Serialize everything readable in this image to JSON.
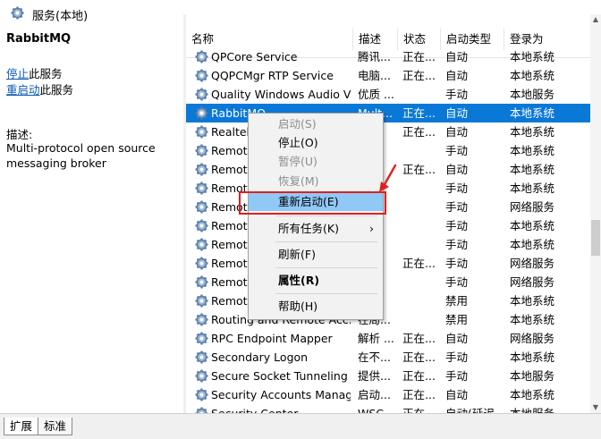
{
  "window": {
    "title": "服务(本地)",
    "icon": "services-gear-icon"
  },
  "left_panel": {
    "service_name": "RabbitMQ",
    "stop_link": "停止",
    "stop_suffix": "此服务",
    "restart_link": "重启动",
    "restart_suffix": "此服务",
    "desc_label": "描述:",
    "description": "Multi-protocol open source messaging broker"
  },
  "columns": [
    "名称",
    "描述",
    "状态",
    "启动类型",
    "登录为"
  ],
  "rows": [
    {
      "name": "QPCore Service",
      "desc": "腾讯...",
      "status": "正在...",
      "startup": "自动",
      "logon": "本地系统"
    },
    {
      "name": "QQPCMgr RTP Service",
      "desc": "电脑...",
      "status": "正在...",
      "startup": "自动",
      "logon": "本地系统"
    },
    {
      "name": "Quality Windows Audio V...",
      "desc": "优质 ...",
      "status": "",
      "startup": "手动",
      "logon": "本地服务"
    },
    {
      "name": "RabbitMQ",
      "desc": "Mult...",
      "status": "正在...",
      "startup": "自动",
      "logon": "本地系统"
    },
    {
      "name": "Realtek...",
      "desc": "",
      "status": "正在...",
      "startup": "自动",
      "logon": "本地系统"
    },
    {
      "name": "Remote...",
      "desc": "",
      "status": "",
      "startup": "手动",
      "logon": "本地系统"
    },
    {
      "name": "Remote...",
      "desc": "",
      "status": "正在...",
      "startup": "自动",
      "logon": "本地系统"
    },
    {
      "name": "Remote...",
      "desc": "",
      "status": "",
      "startup": "手动",
      "logon": "本地系统"
    },
    {
      "name": "Remote...",
      "desc": "",
      "status": "",
      "startup": "手动",
      "logon": "网络服务"
    },
    {
      "name": "Remote...",
      "desc": "",
      "status": "",
      "startup": "手动",
      "logon": "本地系统"
    },
    {
      "name": "Remote...",
      "desc": "",
      "status": "",
      "startup": "手动",
      "logon": "本地系统"
    },
    {
      "name": "Remote...",
      "desc": "",
      "status": "正在...",
      "startup": "手动",
      "logon": "网络服务"
    },
    {
      "name": "Remote...",
      "desc": "",
      "status": "",
      "startup": "手动",
      "logon": "网络服务"
    },
    {
      "name": "Remote...",
      "desc": "",
      "status": "",
      "startup": "禁用",
      "logon": "本地系统"
    },
    {
      "name": "Routing and Remote Acc...",
      "desc": "在局...",
      "status": "",
      "startup": "禁用",
      "logon": "本地系统"
    },
    {
      "name": "RPC Endpoint Mapper",
      "desc": "解析 ...",
      "status": "正在...",
      "startup": "自动",
      "logon": "网络服务"
    },
    {
      "name": "Secondary Logon",
      "desc": "在不...",
      "status": "正在...",
      "startup": "手动",
      "logon": "本地系统"
    },
    {
      "name": "Secure Socket Tunneling ...",
      "desc": "提供...",
      "status": "正在...",
      "startup": "手动",
      "logon": "本地服务"
    },
    {
      "name": "Security Accounts Manag...",
      "desc": "启动...",
      "status": "正在...",
      "startup": "自动",
      "logon": "本地系统"
    },
    {
      "name": "Security Center",
      "desc": "WSC...",
      "status": "正在...",
      "startup": "自动(延迟...",
      "logon": "本地服务"
    }
  ],
  "context_menu": {
    "start": "启动(S)",
    "stop": "停止(O)",
    "pause": "暂停(U)",
    "resume": "恢复(M)",
    "restart": "重新启动(E)",
    "all_tasks": "所有任务(K)",
    "refresh": "刷新(F)",
    "properties": "属性(R)",
    "help": "帮助(H)"
  },
  "tabs": [
    "扩展",
    "标准"
  ],
  "colors": {
    "selection": "#0a78d7",
    "menu_highlight": "#90c8f6",
    "annotation": "#e02020",
    "link": "#0a58b8"
  }
}
